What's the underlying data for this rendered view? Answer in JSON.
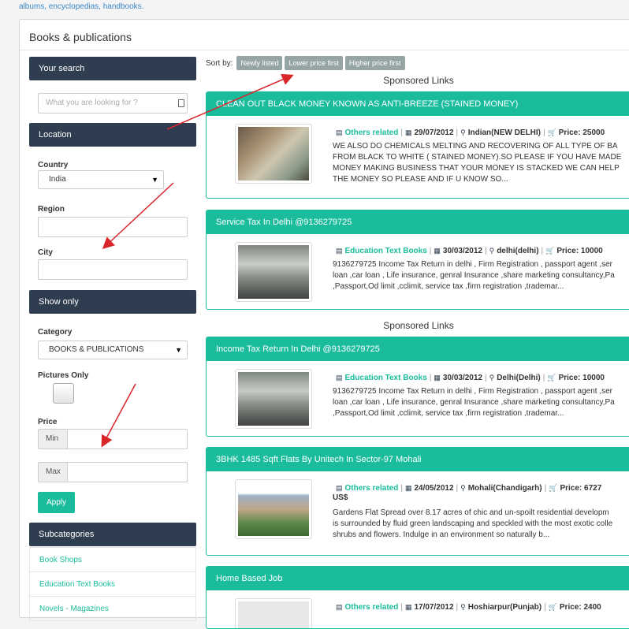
{
  "top": {
    "links": "albums, encyclopedias, handbooks."
  },
  "page": {
    "title": "Books & publications"
  },
  "sidebar": {
    "search_head": "Your search",
    "search_placeholder": "What you are looking for ?",
    "location_head": "Location",
    "country_label": "Country",
    "country_value": "India",
    "region_label": "Region",
    "city_label": "City",
    "show_only_head": "Show only",
    "category_label": "Category",
    "category_value": "BOOKS & PUBLICATIONS",
    "pictures_only_label": "Pictures Only",
    "price_label": "Price",
    "min_label": "Min",
    "max_label": "Max",
    "apply_label": "Apply",
    "subcategories_head": "Subcategories",
    "subcategories": [
      "Book Shops",
      "Education Text Books",
      "Novels - Magazines"
    ]
  },
  "sort": {
    "label": "Sort by:",
    "options": [
      "Newly listed",
      "Lower price first",
      "Higher price first"
    ]
  },
  "sponsored_label": "Sponsored Links",
  "listings": [
    {
      "title": "CLEAN OUT BLACK MONEY KNOWN AS ANTI-BREEZE (STAINED MONEY)",
      "category": "Others related",
      "date": "29/07/2012",
      "location": "Indian(NEW DELHI)",
      "price": "Price: 25000",
      "extra": "",
      "description": "WE ALSO DO CHEMICALS MELTING AND RECOVERING OF ALL TYPE OF BA\nFROM BLACK TO WHITE ( STAINED MONEY).SO PLEASE IF YOU HAVE MADE\nMONEY MAKING BUSINESS THAT YOUR MONEY IS STACKED WE CAN HELP\nTHE MONEY SO PLEASE AND IF U KNOW SO..."
    },
    {
      "title": "Service Tax In Delhi @9136279725",
      "category": "Education Text Books",
      "date": "30/03/2012",
      "location": "delhi(delhi)",
      "price": "Price: 10000",
      "extra": "",
      "description": "9136279725 Income Tax Return in delhi , Firm Registration , passport agent ,ser\nloan ,car loan , Life insurance, genral Insurance ,share marketing consultancy,Pa\n,Passport,Od limit ,cclimit, service tax ,firm registration ,trademar..."
    },
    {
      "title": "Income Tax Return In Delhi @9136279725",
      "category": "Education Text Books",
      "date": "30/03/2012",
      "location": "Delhi(Delhi)",
      "price": "Price: 10000",
      "extra": "",
      "description": "9136279725 Income Tax Return in delhi , Firm Registration , passport agent ,ser\nloan ,car loan , Life insurance, genral Insurance ,share marketing consultancy,Pa\n,Passport,Od limit ,cclimit, service tax ,firm registration ,trademar..."
    },
    {
      "title": "3BHK 1485 Sqft Flats By Unitech In Sector-97 Mohali",
      "category": "Others related",
      "date": "24/05/2012",
      "location": "Mohali(Chandigarh)",
      "price": "Price: 6727",
      "extra": "US$",
      "description": "  Gardens Flat   Spread over 8.17 acres of chic and un-spoilt residential developm\nis surrounded by fluid green landscaping and speckled with the most exotic colle\nshrubs and flowers. Indulge in an environment so naturally b..."
    },
    {
      "title": "Home Based Job",
      "category": "Others related",
      "date": "17/07/2012",
      "location": "Hoshiarpur(Punjab)",
      "price": "Price: 2400",
      "extra": "",
      "description": ""
    }
  ],
  "colors": {
    "accent": "#1abc9c",
    "sidebar_head": "#2e3d4f",
    "annotation_arrow": "#d9262b"
  }
}
